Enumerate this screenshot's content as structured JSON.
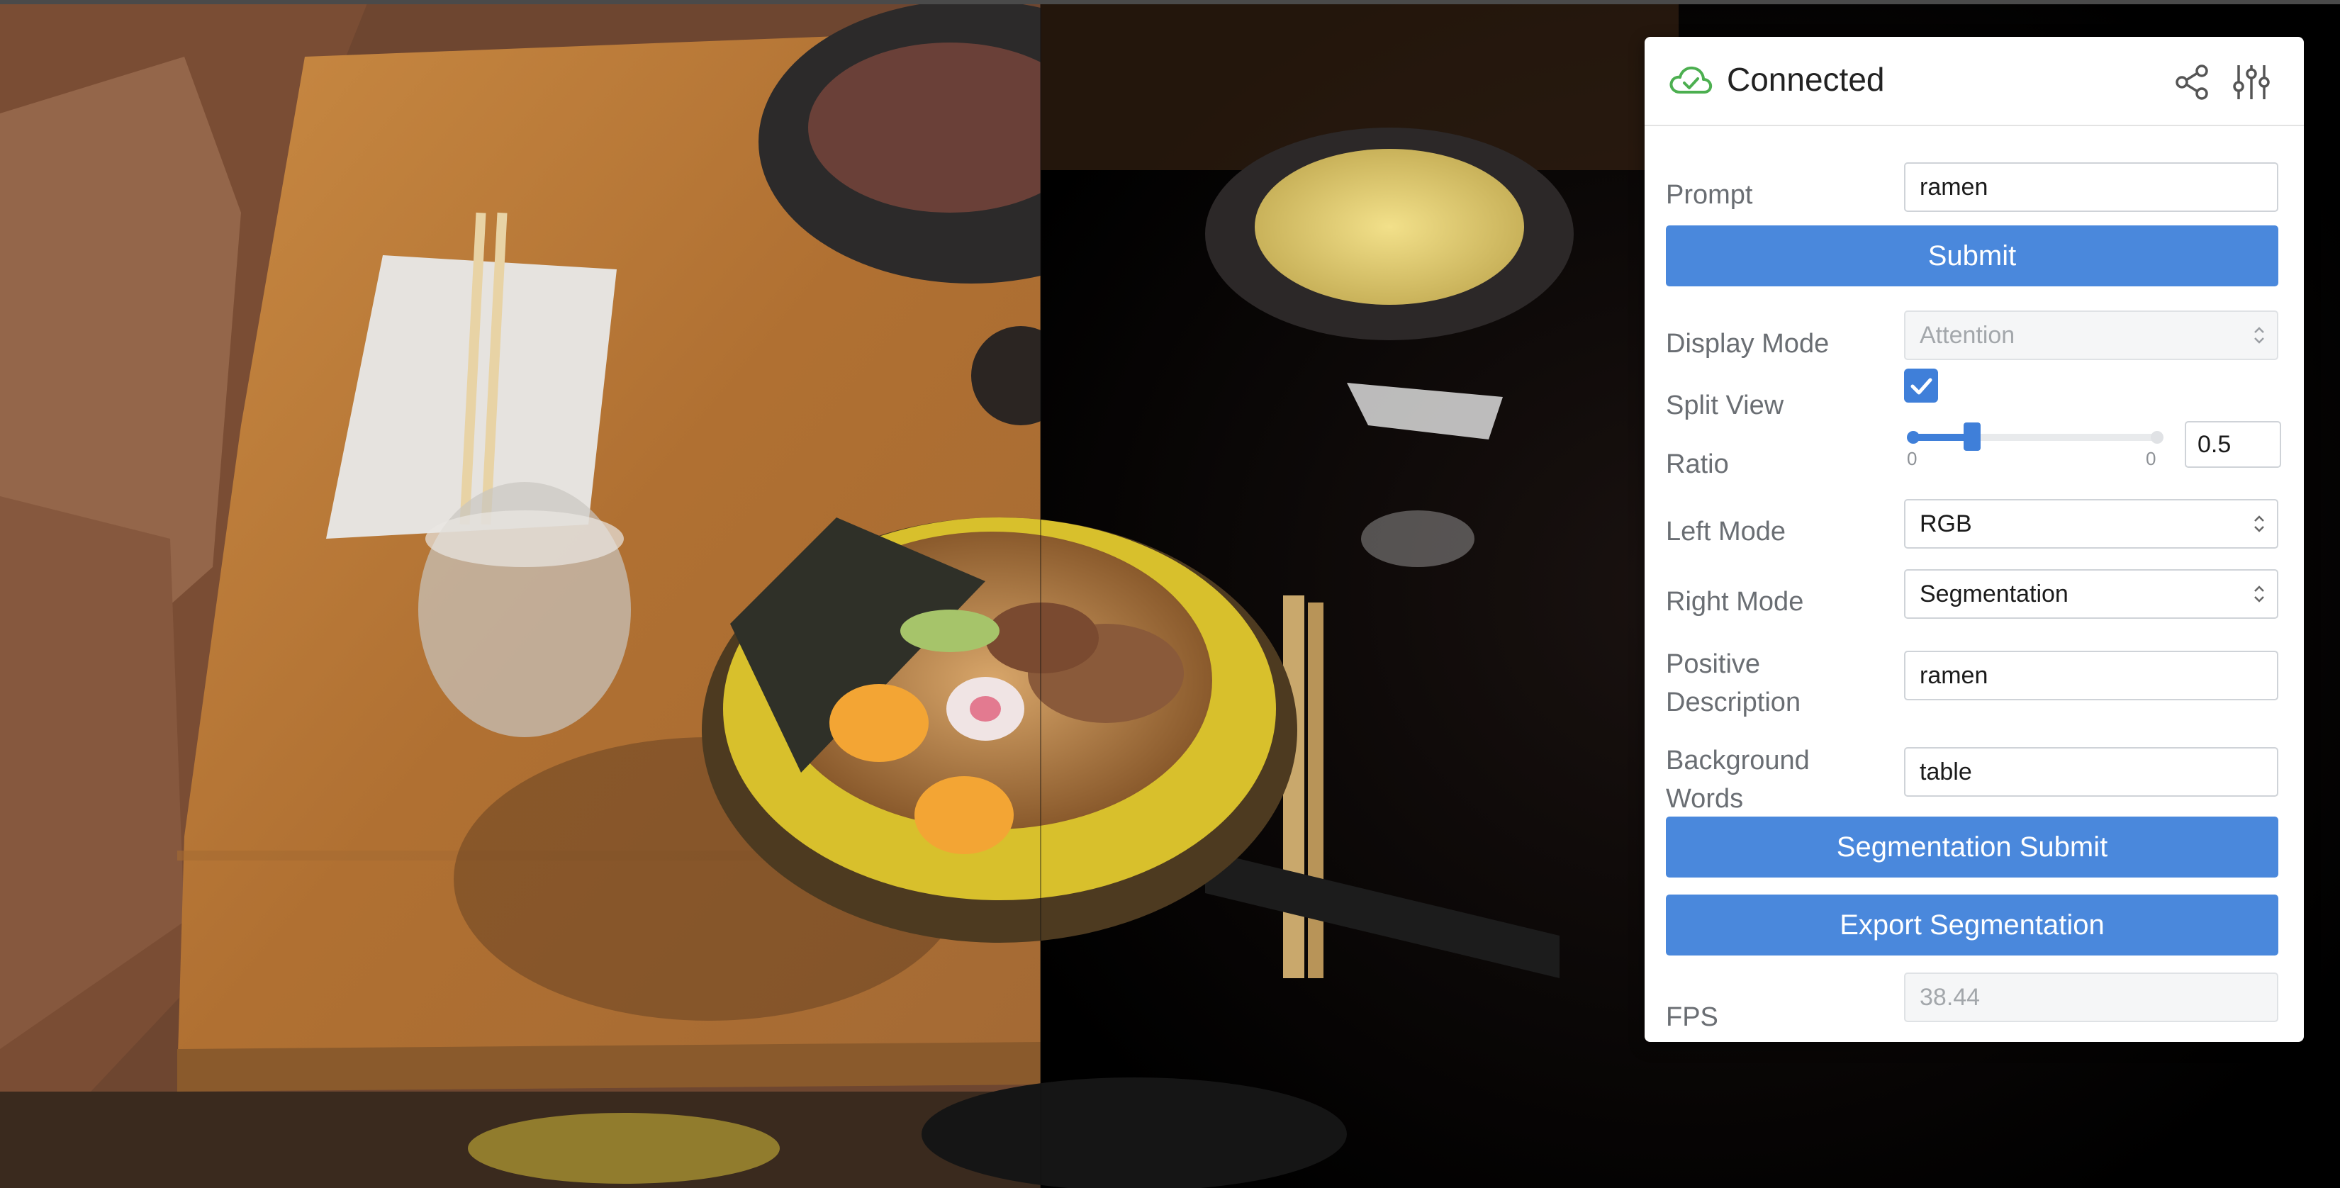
{
  "panel": {
    "status": "Connected",
    "prompt": {
      "label": "Prompt",
      "value": "ramen"
    },
    "submit_label": "Submit",
    "display_mode": {
      "label": "Display Mode",
      "value": "Attention"
    },
    "split_view": {
      "label": "Split View",
      "checked": true
    },
    "ratio": {
      "label": "Ratio",
      "min_label": "0",
      "max_label": "0",
      "value": "0.5",
      "fraction": 0.5
    },
    "left_mode": {
      "label": "Left Mode",
      "value": "RGB"
    },
    "right_mode": {
      "label": "Right Mode",
      "value": "Segmentation"
    },
    "positive": {
      "label_line1": "Positive",
      "label_line2": "Description",
      "value": "ramen"
    },
    "background": {
      "label_line1": "Background",
      "label_line2": "Words",
      "value": "table"
    },
    "seg_submit_label": "Segmentation Submit",
    "export_label": "Export Segmentation",
    "fps": {
      "label": "FPS",
      "value": "38.44"
    },
    "accent_color": "#4a88dc",
    "connected_color": "#4caf50"
  },
  "icons": {
    "status": "cloud-check-icon",
    "share": "share-icon",
    "settings": "sliders-icon"
  }
}
